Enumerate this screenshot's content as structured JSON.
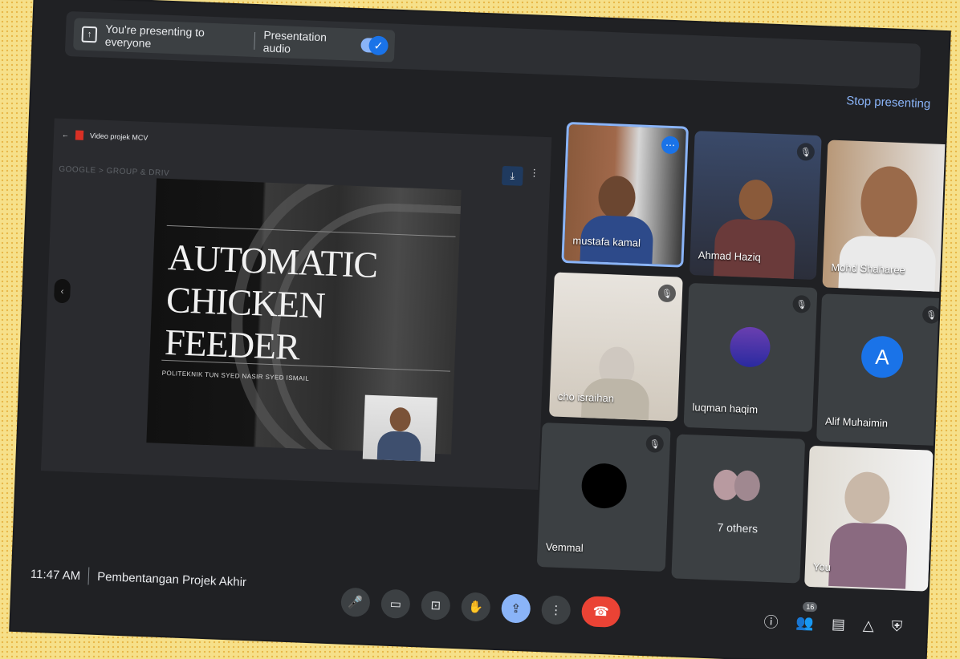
{
  "presenting_bar": {
    "status": "You're presenting to everyone",
    "audio_label": "Presentation audio",
    "audio_enabled": true,
    "stop_label": "Stop presenting"
  },
  "shared_window": {
    "file_title": "Video projek MCV",
    "path_text": "GOOGLE  >  GROUP & DRIV",
    "slide_title_line1": "AUTOMATIC",
    "slide_title_line2": "CHICKEN FEEDER",
    "slide_subtitle": "POLITEKNIK TUN SYED NASIR SYED ISMAIL"
  },
  "participants": [
    {
      "name": "mustafa kamal"
    },
    {
      "name": "Ahmad Haziq"
    },
    {
      "name": "Mohd Shaharee"
    },
    {
      "name": "cho israihan"
    },
    {
      "name": "luqman haqim"
    },
    {
      "name": "Alif Muhaimin",
      "initial": "A"
    },
    {
      "name": "Vemmal"
    },
    {
      "name": "7 others"
    },
    {
      "name": "You"
    }
  ],
  "meeting": {
    "time": "11:47 AM",
    "title": "Pembentangan Projek Akhir",
    "people_count": "16"
  },
  "colors": {
    "accent": "#8ab4f8",
    "end_call": "#ea4335",
    "surface": "#202124",
    "tile": "#3c4043"
  },
  "icons": {
    "mic": "mic-icon",
    "camera": "camera-icon",
    "captions": "captions-icon",
    "hand": "raise-hand-icon",
    "present": "present-icon",
    "more": "more-options-icon",
    "end": "end-call-icon",
    "info": "info-icon",
    "people": "people-icon",
    "chat": "chat-icon",
    "activities": "activities-icon",
    "host": "host-controls-icon"
  }
}
